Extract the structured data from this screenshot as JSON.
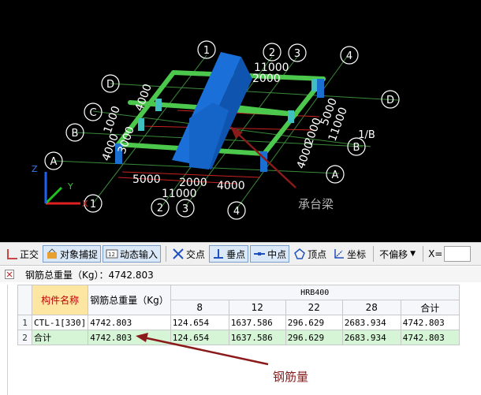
{
  "viewport": {
    "axis_labels": {
      "x": "X",
      "y": "Y",
      "z": "Z"
    },
    "grid_bubbles": [
      "1",
      "2",
      "3",
      "4",
      "A",
      "B",
      "C",
      "D",
      "1/B"
    ],
    "dims": [
      "11000",
      "2000",
      "4000",
      "1000",
      "3000",
      "4000",
      "5000",
      "2000",
      "11000",
      "5000",
      "2000",
      "4000",
      "11000",
      "4000",
      "2000"
    ],
    "callout_label": "承台梁"
  },
  "toolbar": {
    "items": [
      {
        "label": "正交",
        "icon": "ortho-icon",
        "pressed": false
      },
      {
        "label": "对象捕捉",
        "icon": "snap-icon",
        "pressed": true
      },
      {
        "label": "动态输入",
        "icon": "dynamic-input-icon",
        "pressed": true
      },
      {
        "label": "交点",
        "icon": "intersection-icon",
        "pressed": false
      },
      {
        "label": "垂点",
        "icon": "perpendicular-icon",
        "pressed": true
      },
      {
        "label": "中点",
        "icon": "midpoint-icon",
        "pressed": true
      },
      {
        "label": "顶点",
        "icon": "vertex-icon",
        "pressed": false
      },
      {
        "label": "坐标",
        "icon": "coordinate-icon",
        "pressed": false
      }
    ],
    "offset_select": "不偏移",
    "x_label": "X="
  },
  "panel": {
    "title": "钢筋总重量（Kg）：4742.803"
  },
  "table": {
    "header_name": "构件名称",
    "header_total_weight": "钢筋总重量（Kg）",
    "header_group": "HRB400",
    "diameter_headers": [
      "8",
      "12",
      "22",
      "28",
      "合计"
    ],
    "rows": [
      {
        "num": "1",
        "name": "CTL-1[330]",
        "total": "4742.803",
        "values": [
          "124.654",
          "1637.586",
          "296.629",
          "2683.934",
          "4742.803"
        ]
      },
      {
        "num": "2",
        "name": "合计",
        "total": "4742.803",
        "values": [
          "124.654",
          "1637.586",
          "296.629",
          "2683.934",
          "4742.803"
        ]
      }
    ]
  },
  "annotation": {
    "label": "钢筋量"
  }
}
